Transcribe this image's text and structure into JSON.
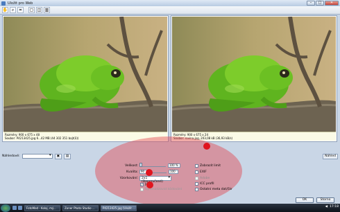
{
  "window": {
    "title": "Uložit pro Web",
    "min": "–",
    "max": "□",
    "close": "✕"
  },
  "toolbar": {
    "icons": [
      "hand-icon",
      "zoom-icon",
      "crop-icon",
      "single-view-icon",
      "split-view-icon",
      "compare-view-icon"
    ]
  },
  "left_pane": {
    "line1": "Rozměry: 900 x 675 x 48",
    "line2": "Soubor: P4213425.jpg 6...42 MB (44 302 351 bajt(ů))"
  },
  "right_pane": {
    "line1": "Rozměry: 900 x 675 x 24",
    "line2": "Soubor: rovina.jpg, 203,08 kB (36,93 kB/s)"
  },
  "zoom": {
    "label": "Náhledové:",
    "value": "",
    "button": "Náhled"
  },
  "settings": {
    "quality": {
      "label": "Velikost:",
      "value": "100 %"
    },
    "resize": {
      "label": "Kvalita:",
      "value": "90",
      "max": "100"
    },
    "subsampling": {
      "label": "Vzorkování:",
      "value": "2x1 (Doporučené)"
    },
    "progressive": {
      "label": "Jen",
      "checked": "✓"
    },
    "option_faded": "Optimalizovat kódování"
  },
  "options": [
    {
      "label": "Zobrazit limit",
      "disabled": false
    },
    {
      "label": "EXIF",
      "disabled": false
    },
    {
      "label": "Adobe",
      "disabled": true
    },
    {
      "label": "ICC profil",
      "disabled": false
    },
    {
      "label": "Ostatní meta dat/čár",
      "disabled": false
    }
  ],
  "buttons": {
    "ok": "OK",
    "cancel": "Storno"
  },
  "taskbar": {
    "tasks": [
      "FotoMed - Kolaj, mý...",
      "Zoner Photo Studio ...",
      "P4213425.jpg [Uložit ..."
    ],
    "clock": "17:18"
  }
}
